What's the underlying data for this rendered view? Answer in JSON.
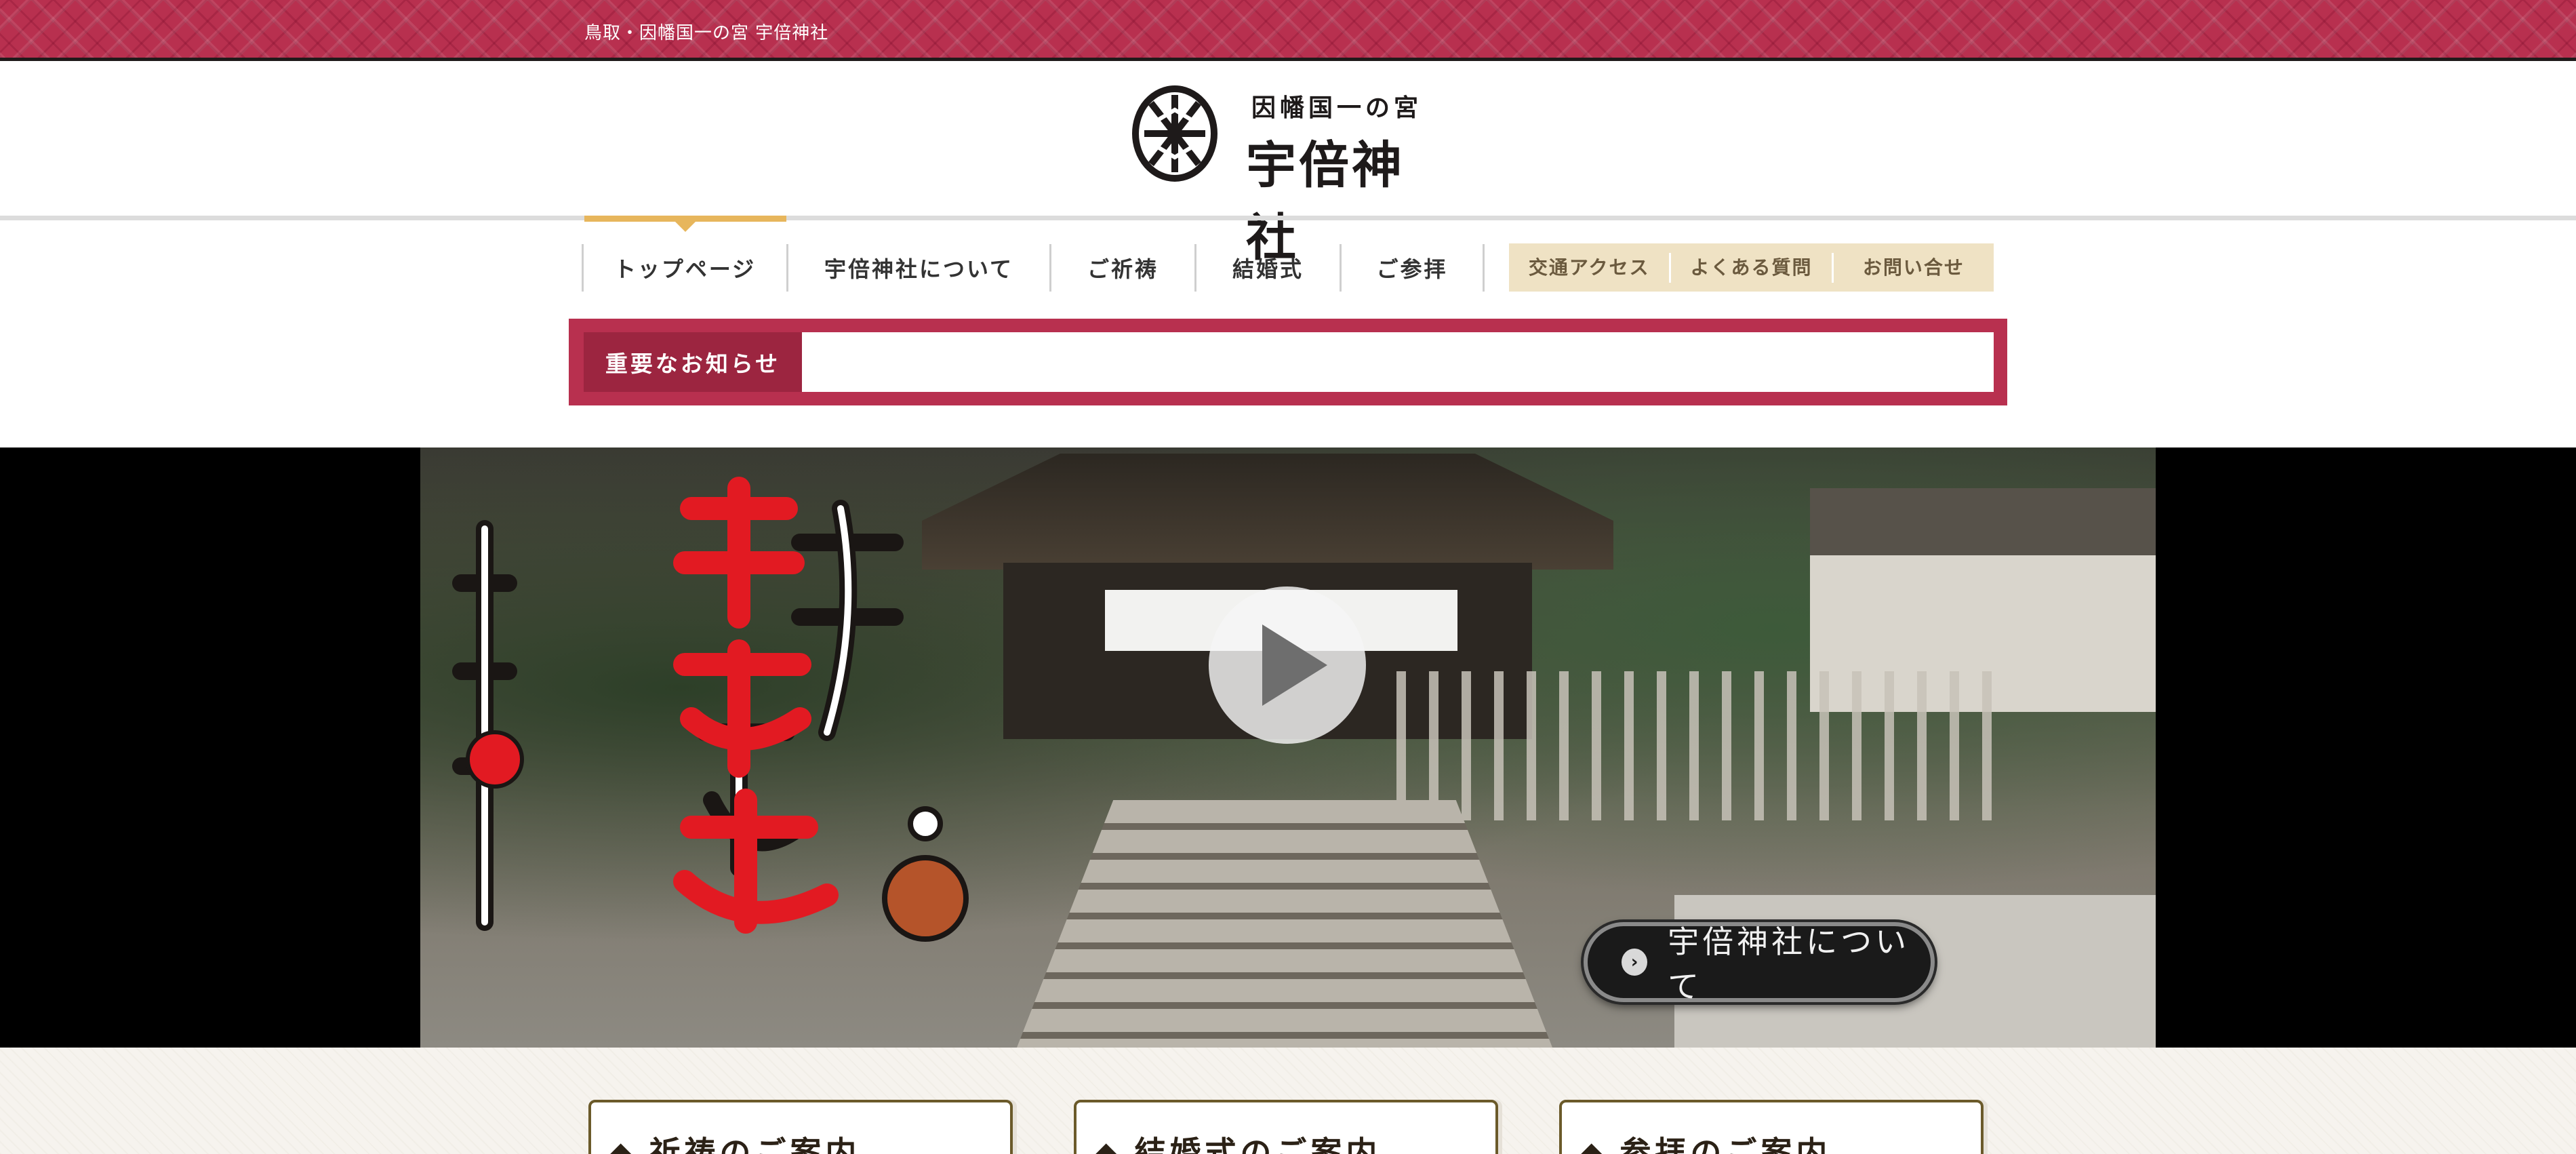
{
  "topbar": {
    "text": "鳥取・因幡国一の宮 宇倍神社"
  },
  "logo": {
    "sub": "因幡国一の宮",
    "main": "宇倍神社"
  },
  "nav": {
    "items": [
      "トップページ",
      "宇倍神社について",
      "ご祈祷",
      "結婚式",
      "ご参拝"
    ],
    "active_index": 0
  },
  "subnav": {
    "items": [
      "交通アクセス",
      "よくある質問",
      "お問い合せ"
    ]
  },
  "notice": {
    "label": "重要なお知らせ",
    "content": ""
  },
  "hero": {
    "about_label": "宇倍神社について",
    "play_icon": "play-icon"
  },
  "cards": [
    {
      "title": "祈祷のご案内"
    },
    {
      "title": "結婚式のご案内"
    },
    {
      "title": "参拝のご案内"
    }
  ],
  "colors": {
    "brand": "#b8304f",
    "brand_dark": "#9c2540",
    "nav_accent": "#e7b65c",
    "subnav_bg": "#efe2c4",
    "card_border": "#6b5a2a"
  }
}
